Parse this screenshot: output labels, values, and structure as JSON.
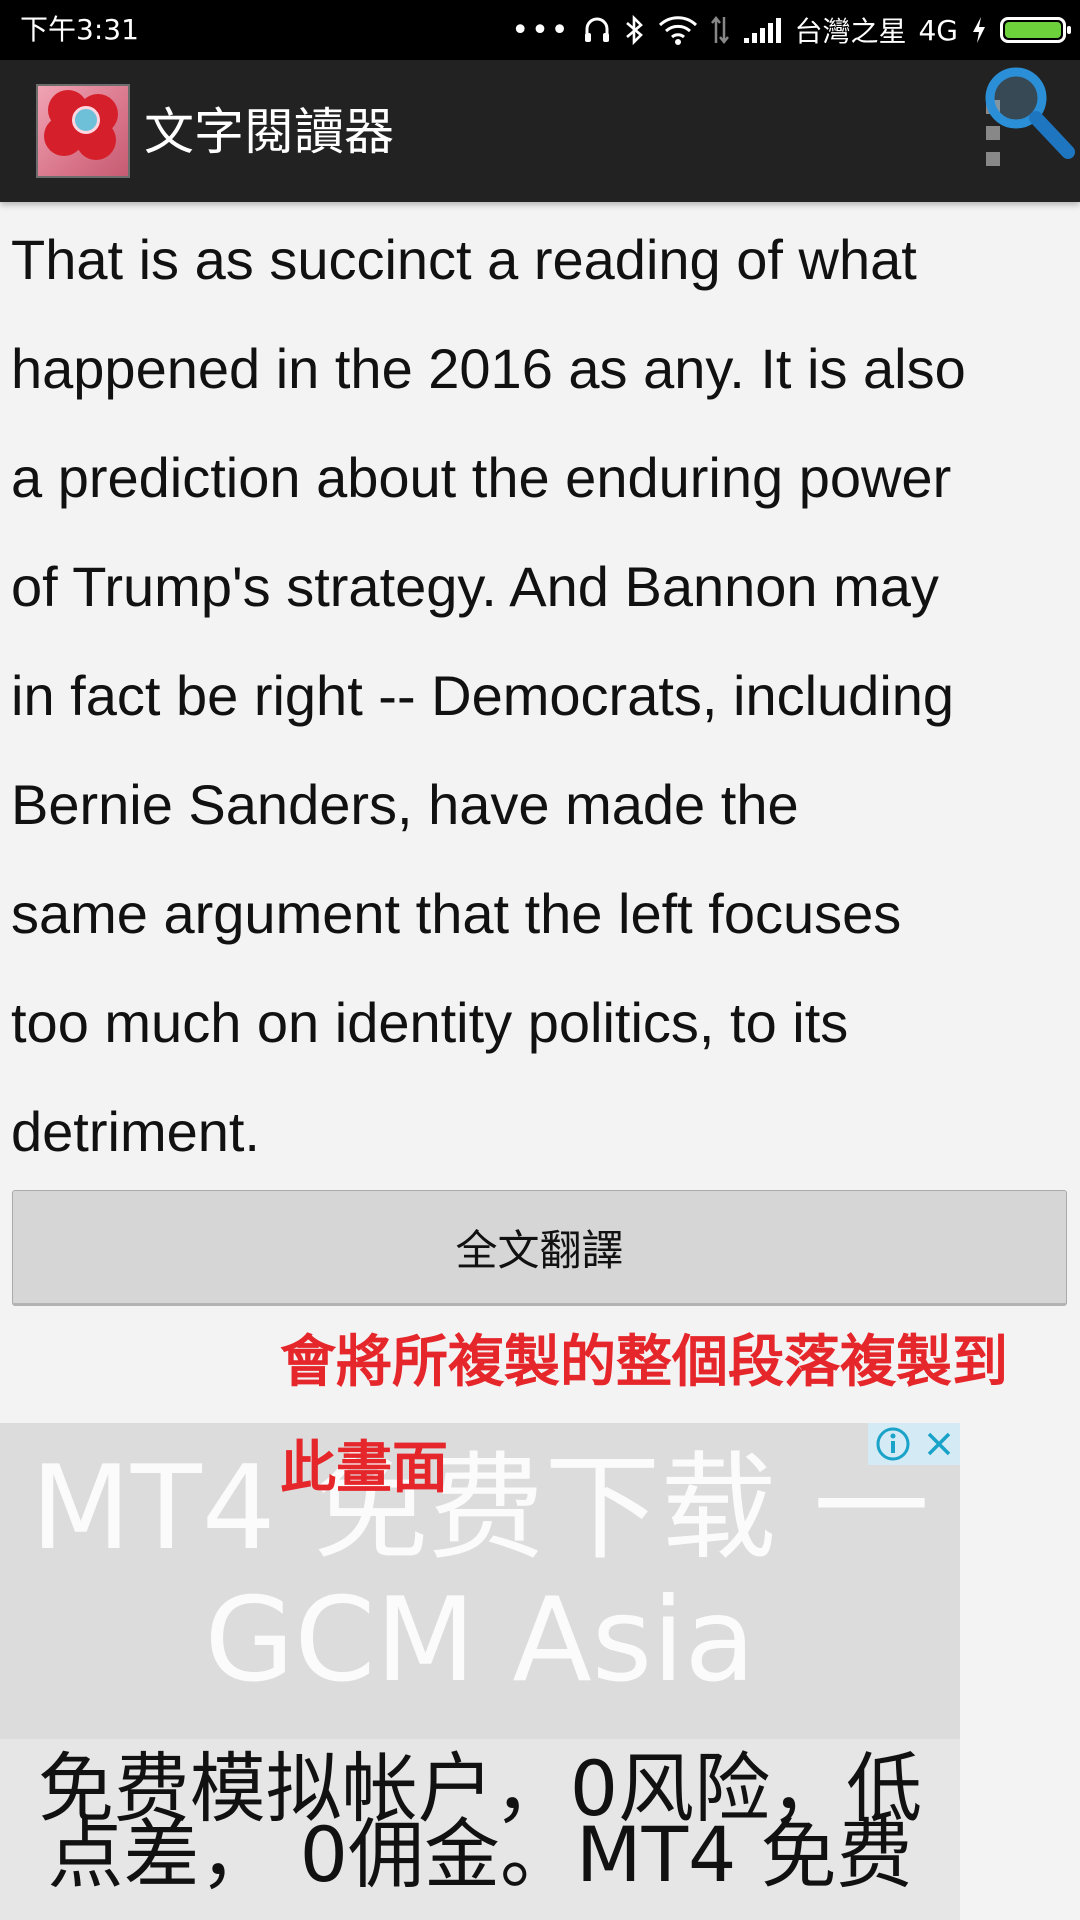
{
  "status_bar": {
    "time": "下午3:31",
    "carrier": "台灣之星",
    "network": "4G",
    "icons": [
      "more-dots-icon",
      "headset-icon",
      "bluetooth-icon",
      "wifi-icon",
      "data-arrows-icon",
      "signal-icon",
      "charging-icon",
      "battery-icon"
    ],
    "battery_color": "#6cd13a"
  },
  "action_bar": {
    "title": "文字閱讀器",
    "icons": [
      "app-flower-icon",
      "overflow-menu-icon",
      "search-icon"
    ],
    "search_icon_color": "#2a8fd6"
  },
  "reading": {
    "text": "That is as succinct a reading of what\nhappened in the 2016 as any. It is also\na prediction about the enduring power\nof Trump's strategy. And Bannon may\nin fact be right -- Democrats, including\nBernie Sanders, have made the\nsame argument that the left focuses\ntoo much on identity politics, to its\ndetriment."
  },
  "translate_button": {
    "label": "全文翻譯"
  },
  "annotation": {
    "text": "會將所複製的整個段落複製到此畫面",
    "color": "#e5262b"
  },
  "ad": {
    "headline": "MT4 免费下载 一\nGCM Asia",
    "body": "免费模拟帐户，0风险，低\n点差， 0佣金。MT4 免费",
    "choices_icons": [
      "info-icon",
      "close-icon"
    ]
  }
}
